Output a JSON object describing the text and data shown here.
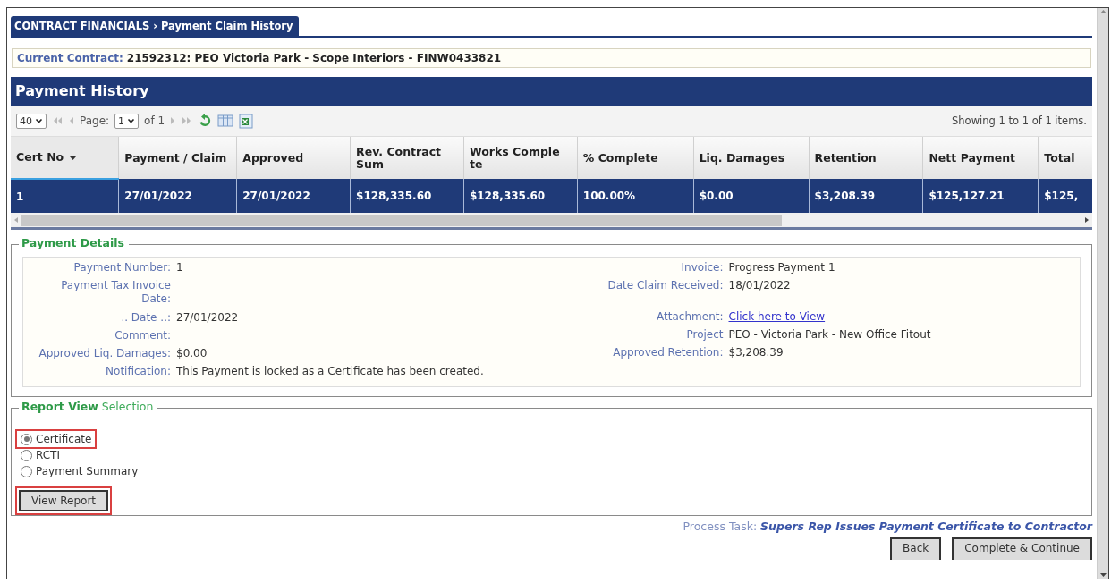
{
  "tab": {
    "section": "CONTRACT FINANCIALS",
    "separator": "›",
    "page": "Payment Claim History"
  },
  "current_contract": {
    "label": "Current Contract:",
    "value": "21592312: PEO Victoria Park - Scope Interiors - FINW0433821"
  },
  "grid": {
    "title": "Payment History",
    "pager": {
      "page_size": "40",
      "page_label": "Page:",
      "page": "1",
      "page_count": "of 1",
      "showing": "Showing 1 to 1 of 1 items."
    },
    "columns": [
      {
        "label": "Cert No",
        "sorted": true
      },
      {
        "label": "Payment / Claim",
        "sorted": false
      },
      {
        "label": "Approved",
        "sorted": false
      },
      {
        "label": "Rev. Contract Sum",
        "sorted": false
      },
      {
        "label": "Works Comple te",
        "sorted": false
      },
      {
        "label": "% Complete",
        "sorted": false
      },
      {
        "label": "Liq. Damages",
        "sorted": false
      },
      {
        "label": "Retention",
        "sorted": false
      },
      {
        "label": "Nett Payment",
        "sorted": false
      },
      {
        "label": "Total",
        "sorted": false
      }
    ],
    "rows": [
      {
        "selected": true,
        "cells": [
          "1",
          "27/01/2022",
          "27/01/2022",
          "$128,335.60",
          "$128,335.60",
          "100.00%",
          "$0.00",
          "$3,208.39",
          "$125,127.21",
          "$125,"
        ]
      }
    ]
  },
  "payment_details": {
    "title": "Payment Details",
    "left": [
      {
        "label": "Payment Number:",
        "value": "1"
      },
      {
        "label": "Payment Tax Invoice Date:"
      },
      {
        "label": ".. Date ..:",
        "value": "27/01/2022"
      },
      {
        "label": "Comment:"
      },
      {
        "label": "Approved Liq. Damages:",
        "value": "$0.00"
      }
    ],
    "right": [
      {
        "label": "Invoice:",
        "value": "Progress Payment 1"
      },
      {
        "label": "Date Claim Received:",
        "value": "18/01/2022"
      },
      {
        "label": "Attachment:",
        "value": "Click here to View",
        "kind": "link"
      },
      {
        "label": "Project",
        "value": "PEO - Victoria Park - New Office Fitout"
      },
      {
        "label": "Approved Retention:",
        "value": "$3,208.39"
      }
    ],
    "notification": {
      "label": "Notification:",
      "value": "This Payment is locked as a Certificate has been created."
    }
  },
  "report_view": {
    "title": "Report View",
    "title_suffix": "Selection",
    "options": [
      {
        "label": "Certificate",
        "selected": true,
        "highlighted": true
      },
      {
        "label": "RCTI",
        "selected": false,
        "highlighted": false
      },
      {
        "label": "Payment Summary",
        "selected": false,
        "highlighted": false
      }
    ],
    "button": {
      "label": "View Report",
      "highlighted": true
    }
  },
  "process_task": {
    "label": "Process Task:",
    "task": "Supers Rep Issues Payment Certificate to Contractor"
  },
  "buttons": [
    "Back",
    "Complete & Continue"
  ]
}
